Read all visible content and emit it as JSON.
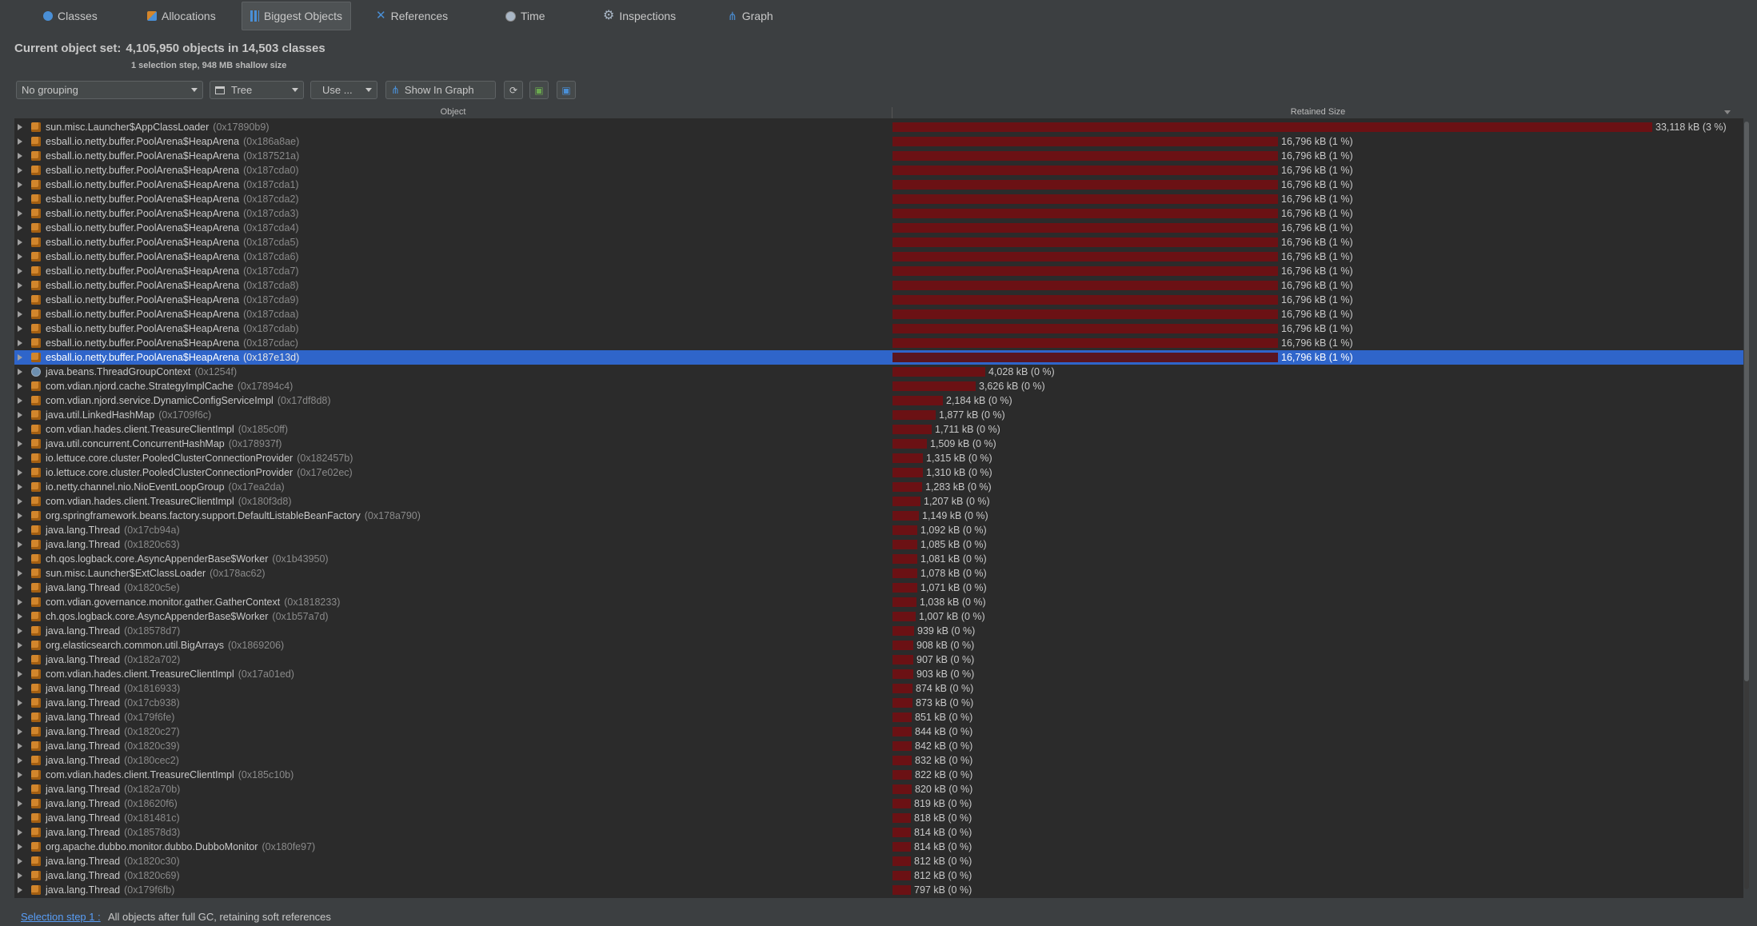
{
  "tabs": [
    {
      "label": "Classes",
      "icon": "classes-icon",
      "selected": false
    },
    {
      "label": "Allocations",
      "icon": "allocations-icon",
      "selected": false
    },
    {
      "label": "Biggest Objects",
      "icon": "biggest-objects-icon",
      "selected": true
    },
    {
      "label": "References",
      "icon": "references-icon",
      "selected": false
    },
    {
      "label": "Time",
      "icon": "time-icon",
      "selected": false
    },
    {
      "label": "Inspections",
      "icon": "inspections-icon",
      "selected": false
    },
    {
      "label": "Graph",
      "icon": "graph-icon",
      "selected": false
    }
  ],
  "header": {
    "title_label": "Current object set:",
    "title_value": "4,105,950 objects in 14,503 classes",
    "subtitle": "1 selection step, 948 MB shallow size"
  },
  "toolbar": {
    "grouping": "No grouping",
    "view": "Tree",
    "use_label": "Use ...",
    "show_in_graph": "Show In Graph",
    "refresh_icon": "refresh-icon",
    "save_icon": "save-icon",
    "info_icon": "info-icon"
  },
  "table": {
    "col_object": "Object",
    "col_retained": "Retained Size",
    "max_kb": 33118,
    "rows": [
      {
        "name": "sun.misc.Launcher$AppClassLoader",
        "id": "(0x17890b9)",
        "kb": 33118,
        "size": "33,118 kB (3 %)"
      },
      {
        "name": "esball.io.netty.buffer.PoolArena$HeapArena",
        "id": "(0x186a8ae)",
        "kb": 16796,
        "size": "16,796 kB (1 %)"
      },
      {
        "name": "esball.io.netty.buffer.PoolArena$HeapArena",
        "id": "(0x187521a)",
        "kb": 16796,
        "size": "16,796 kB (1 %)"
      },
      {
        "name": "esball.io.netty.buffer.PoolArena$HeapArena",
        "id": "(0x187cda0)",
        "kb": 16796,
        "size": "16,796 kB (1 %)"
      },
      {
        "name": "esball.io.netty.buffer.PoolArena$HeapArena",
        "id": "(0x187cda1)",
        "kb": 16796,
        "size": "16,796 kB (1 %)"
      },
      {
        "name": "esball.io.netty.buffer.PoolArena$HeapArena",
        "id": "(0x187cda2)",
        "kb": 16796,
        "size": "16,796 kB (1 %)"
      },
      {
        "name": "esball.io.netty.buffer.PoolArena$HeapArena",
        "id": "(0x187cda3)",
        "kb": 16796,
        "size": "16,796 kB (1 %)"
      },
      {
        "name": "esball.io.netty.buffer.PoolArena$HeapArena",
        "id": "(0x187cda4)",
        "kb": 16796,
        "size": "16,796 kB (1 %)"
      },
      {
        "name": "esball.io.netty.buffer.PoolArena$HeapArena",
        "id": "(0x187cda5)",
        "kb": 16796,
        "size": "16,796 kB (1 %)"
      },
      {
        "name": "esball.io.netty.buffer.PoolArena$HeapArena",
        "id": "(0x187cda6)",
        "kb": 16796,
        "size": "16,796 kB (1 %)"
      },
      {
        "name": "esball.io.netty.buffer.PoolArena$HeapArena",
        "id": "(0x187cda7)",
        "kb": 16796,
        "size": "16,796 kB (1 %)"
      },
      {
        "name": "esball.io.netty.buffer.PoolArena$HeapArena",
        "id": "(0x187cda8)",
        "kb": 16796,
        "size": "16,796 kB (1 %)"
      },
      {
        "name": "esball.io.netty.buffer.PoolArena$HeapArena",
        "id": "(0x187cda9)",
        "kb": 16796,
        "size": "16,796 kB (1 %)"
      },
      {
        "name": "esball.io.netty.buffer.PoolArena$HeapArena",
        "id": "(0x187cdaa)",
        "kb": 16796,
        "size": "16,796 kB (1 %)"
      },
      {
        "name": "esball.io.netty.buffer.PoolArena$HeapArena",
        "id": "(0x187cdab)",
        "kb": 16796,
        "size": "16,796 kB (1 %)"
      },
      {
        "name": "esball.io.netty.buffer.PoolArena$HeapArena",
        "id": "(0x187cdac)",
        "kb": 16796,
        "size": "16,796 kB (1 %)"
      },
      {
        "name": "esball.io.netty.buffer.PoolArena$HeapArena",
        "id": "(0x187e13d)",
        "kb": 16796,
        "size": "16,796 kB (1 %)",
        "selected": true
      },
      {
        "name": "java.beans.ThreadGroupContext",
        "id": "(0x1254f)",
        "kb": 4028,
        "size": "4,028 kB (0 %)",
        "icon": "class"
      },
      {
        "name": "com.vdian.njord.cache.StrategyImplCache",
        "id": "(0x17894c4)",
        "kb": 3626,
        "size": "3,626 kB (0 %)"
      },
      {
        "name": "com.vdian.njord.service.DynamicConfigServiceImpl",
        "id": "(0x17df8d8)",
        "kb": 2184,
        "size": "2,184 kB (0 %)"
      },
      {
        "name": "java.util.LinkedHashMap",
        "id": "(0x1709f6c)",
        "kb": 1877,
        "size": "1,877 kB (0 %)"
      },
      {
        "name": "com.vdian.hades.client.TreasureClientImpl",
        "id": "(0x185c0ff)",
        "kb": 1711,
        "size": "1,711 kB (0 %)"
      },
      {
        "name": "java.util.concurrent.ConcurrentHashMap",
        "id": "(0x178937f)",
        "kb": 1509,
        "size": "1,509 kB (0 %)"
      },
      {
        "name": "io.lettuce.core.cluster.PooledClusterConnectionProvider",
        "id": "(0x182457b)",
        "kb": 1315,
        "size": "1,315 kB (0 %)"
      },
      {
        "name": "io.lettuce.core.cluster.PooledClusterConnectionProvider",
        "id": "(0x17e02ec)",
        "kb": 1310,
        "size": "1,310 kB (0 %)"
      },
      {
        "name": "io.netty.channel.nio.NioEventLoopGroup",
        "id": "(0x17ea2da)",
        "kb": 1283,
        "size": "1,283 kB (0 %)"
      },
      {
        "name": "com.vdian.hades.client.TreasureClientImpl",
        "id": "(0x180f3d8)",
        "kb": 1207,
        "size": "1,207 kB (0 %)"
      },
      {
        "name": "org.springframework.beans.factory.support.DefaultListableBeanFactory",
        "id": "(0x178a790)",
        "kb": 1149,
        "size": "1,149 kB (0 %)"
      },
      {
        "name": "java.lang.Thread",
        "id": "(0x17cb94a)",
        "kb": 1092,
        "size": "1,092 kB (0 %)"
      },
      {
        "name": "java.lang.Thread",
        "id": "(0x1820c63)",
        "kb": 1085,
        "size": "1,085 kB (0 %)"
      },
      {
        "name": "ch.qos.logback.core.AsyncAppenderBase$Worker",
        "id": "(0x1b43950)",
        "kb": 1081,
        "size": "1,081 kB (0 %)"
      },
      {
        "name": "sun.misc.Launcher$ExtClassLoader",
        "id": "(0x178ac62)",
        "kb": 1078,
        "size": "1,078 kB (0 %)"
      },
      {
        "name": "java.lang.Thread",
        "id": "(0x1820c5e)",
        "kb": 1071,
        "size": "1,071 kB (0 %)"
      },
      {
        "name": "com.vdian.governance.monitor.gather.GatherContext",
        "id": "(0x1818233)",
        "kb": 1038,
        "size": "1,038 kB (0 %)"
      },
      {
        "name": "ch.qos.logback.core.AsyncAppenderBase$Worker",
        "id": "(0x1b57a7d)",
        "kb": 1007,
        "size": "1,007 kB (0 %)"
      },
      {
        "name": "java.lang.Thread",
        "id": "(0x18578d7)",
        "kb": 939,
        "size": "939 kB (0 %)"
      },
      {
        "name": "org.elasticsearch.common.util.BigArrays",
        "id": "(0x1869206)",
        "kb": 908,
        "size": "908 kB (0 %)"
      },
      {
        "name": "java.lang.Thread",
        "id": "(0x182a702)",
        "kb": 907,
        "size": "907 kB (0 %)"
      },
      {
        "name": "com.vdian.hades.client.TreasureClientImpl",
        "id": "(0x17a01ed)",
        "kb": 903,
        "size": "903 kB (0 %)"
      },
      {
        "name": "java.lang.Thread",
        "id": "(0x1816933)",
        "kb": 874,
        "size": "874 kB (0 %)"
      },
      {
        "name": "java.lang.Thread",
        "id": "(0x17cb938)",
        "kb": 873,
        "size": "873 kB (0 %)"
      },
      {
        "name": "java.lang.Thread",
        "id": "(0x179f6fe)",
        "kb": 851,
        "size": "851 kB (0 %)"
      },
      {
        "name": "java.lang.Thread",
        "id": "(0x1820c27)",
        "kb": 844,
        "size": "844 kB (0 %)"
      },
      {
        "name": "java.lang.Thread",
        "id": "(0x1820c39)",
        "kb": 842,
        "size": "842 kB (0 %)"
      },
      {
        "name": "java.lang.Thread",
        "id": "(0x180cec2)",
        "kb": 832,
        "size": "832 kB (0 %)"
      },
      {
        "name": "com.vdian.hades.client.TreasureClientImpl",
        "id": "(0x185c10b)",
        "kb": 822,
        "size": "822 kB (0 %)"
      },
      {
        "name": "java.lang.Thread",
        "id": "(0x182a70b)",
        "kb": 820,
        "size": "820 kB (0 %)"
      },
      {
        "name": "java.lang.Thread",
        "id": "(0x18620f6)",
        "kb": 819,
        "size": "819 kB (0 %)"
      },
      {
        "name": "java.lang.Thread",
        "id": "(0x181481c)",
        "kb": 818,
        "size": "818 kB (0 %)"
      },
      {
        "name": "java.lang.Thread",
        "id": "(0x18578d3)",
        "kb": 814,
        "size": "814 kB (0 %)"
      },
      {
        "name": "org.apache.dubbo.monitor.dubbo.DubboMonitor",
        "id": "(0x180fe97)",
        "kb": 814,
        "size": "814 kB (0 %)"
      },
      {
        "name": "java.lang.Thread",
        "id": "(0x1820c30)",
        "kb": 812,
        "size": "812 kB (0 %)"
      },
      {
        "name": "java.lang.Thread",
        "id": "(0x1820c69)",
        "kb": 812,
        "size": "812 kB (0 %)"
      },
      {
        "name": "java.lang.Thread",
        "id": "(0x179f6fb)",
        "kb": 797,
        "size": "797 kB (0 %)"
      }
    ]
  },
  "footer": {
    "link": "Selection step 1 :",
    "text": "All objects after full GC, retaining soft references"
  },
  "colors": {
    "bar": "#6b1114",
    "selection": "#2f65ca",
    "background": "#3c3f41",
    "object_icon": "#d2862c"
  }
}
